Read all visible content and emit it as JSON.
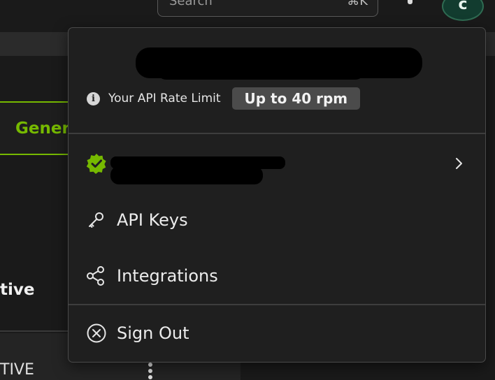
{
  "header": {
    "search": {
      "placeholder": "Search",
      "shortcut": "⌘K"
    },
    "avatar_initial": "c"
  },
  "background": {
    "tab_label": "Gener",
    "status_text": "tive",
    "table_cell": "TIVE"
  },
  "menu": {
    "rate_limit_label": "Your API Rate Limit",
    "rate_limit_value": "Up to 40 rpm",
    "items": [
      {
        "label": "API Keys",
        "icon": "key-icon"
      },
      {
        "label": "Integrations",
        "icon": "share-nodes-icon"
      },
      {
        "label": "Sign Out",
        "icon": "close-circle-icon"
      }
    ]
  },
  "colors": {
    "accent": "#76b900",
    "menu_bg": "#1f1f1f",
    "badge_bg": "#4b4b4b",
    "avatar_bg": "#123c2f"
  }
}
